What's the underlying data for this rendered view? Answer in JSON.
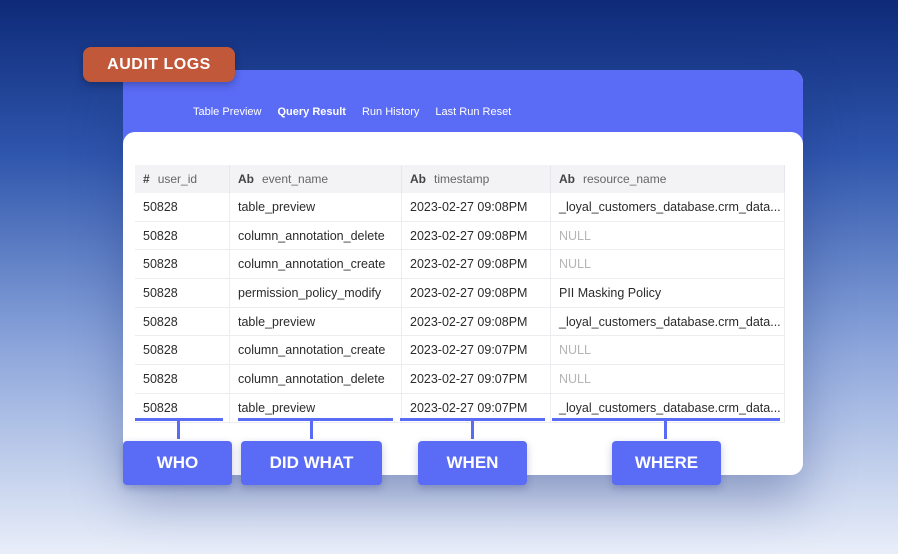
{
  "badge": "AUDIT LOGS",
  "tabs": [
    "Table Preview",
    "Query Result",
    "Run History",
    "Last Run Reset"
  ],
  "active_tab": "Query Result",
  "columns": [
    {
      "type_icon": "#",
      "name": "user_id"
    },
    {
      "type_icon": "Ab",
      "name": "event_name"
    },
    {
      "type_icon": "Ab",
      "name": "timestamp"
    },
    {
      "type_icon": "Ab",
      "name": "resource_name"
    }
  ],
  "rows": [
    [
      "50828",
      "table_preview",
      "2023-02-27 09:08PM",
      "_loyal_customers_database.crm_data..."
    ],
    [
      "50828",
      "column_annotation_delete",
      "2023-02-27 09:08PM",
      "NULL"
    ],
    [
      "50828",
      "column_annotation_create",
      "2023-02-27 09:08PM",
      "NULL"
    ],
    [
      "50828",
      "permission_policy_modify",
      "2023-02-27 09:08PM",
      "PII Masking Policy"
    ],
    [
      "50828",
      "table_preview",
      "2023-02-27 09:08PM",
      "_loyal_customers_database.crm_data..."
    ],
    [
      "50828",
      "column_annotation_create",
      "2023-02-27 09:07PM",
      "NULL"
    ],
    [
      "50828",
      "column_annotation_delete",
      "2023-02-27 09:07PM",
      "NULL"
    ],
    [
      "50828",
      "table_preview",
      "2023-02-27 09:07PM",
      "_loyal_customers_database.crm_data..."
    ]
  ],
  "labels": [
    "WHO",
    "DID WHAT",
    "WHEN",
    "WHERE"
  ],
  "colors": {
    "accent": "#5a6bf5",
    "badge": "#c2583a",
    "null_text": "#b5b5b5"
  }
}
